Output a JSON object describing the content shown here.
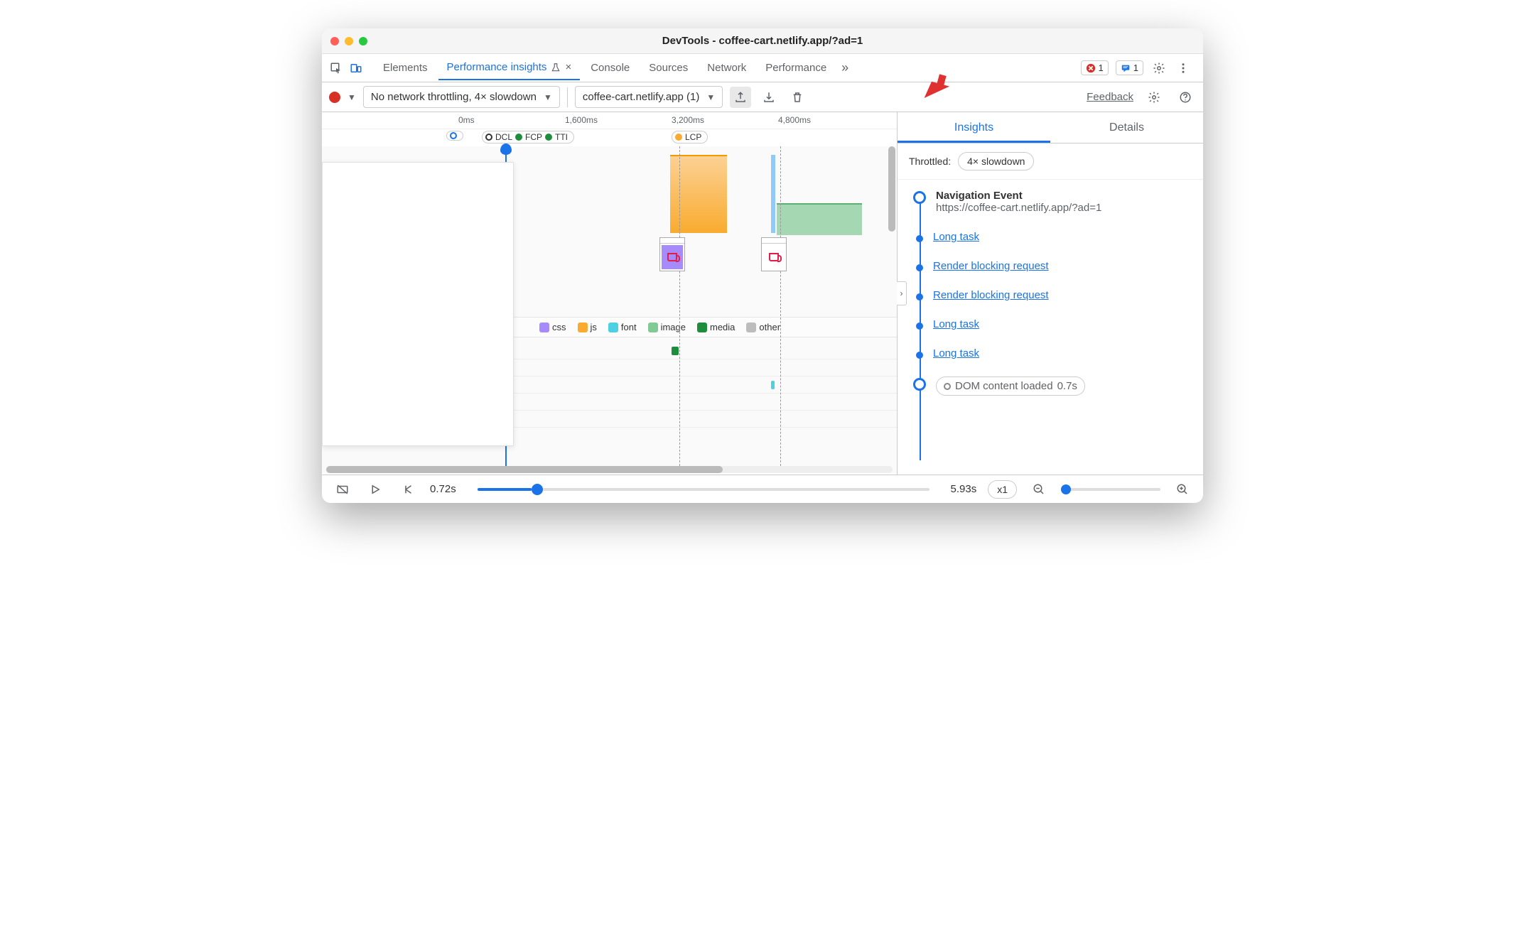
{
  "window": {
    "title": "DevTools - coffee-cart.netlify.app/?ad=1"
  },
  "tabbar": {
    "tabs": [
      "Elements",
      "Performance insights",
      "Console",
      "Sources",
      "Network",
      "Performance"
    ],
    "errors": "1",
    "messages": "1"
  },
  "toolbar": {
    "throttling_select": "No network throttling, 4× slowdown",
    "recording_select": "coffee-cart.netlify.app (1)",
    "feedback": "Feedback"
  },
  "ruler": {
    "t0": "0ms",
    "t1": "1,600ms",
    "t2": "3,200ms",
    "t3": "4,800ms"
  },
  "markers": {
    "dcl": "DCL",
    "fcp": "FCP",
    "tti": "TTI",
    "lcp": "LCP"
  },
  "legend": {
    "css": "css",
    "js": "js",
    "font": "font",
    "image": "image",
    "media": "media",
    "other": "other"
  },
  "right": {
    "tab_insights": "Insights",
    "tab_details": "Details",
    "throttled_label": "Throttled:",
    "throttled_value": "4× slowdown",
    "nav_title": "Navigation Event",
    "nav_url": "https://coffee-cart.netlify.app/?ad=1",
    "items": [
      "Long task",
      "Render blocking request",
      "Render blocking request",
      "Long task",
      "Long task"
    ],
    "dom_label": "DOM content loaded",
    "dom_time": "0.7s"
  },
  "footer": {
    "start_time": "0.72s",
    "end_time": "5.93s",
    "speed": "x1"
  }
}
